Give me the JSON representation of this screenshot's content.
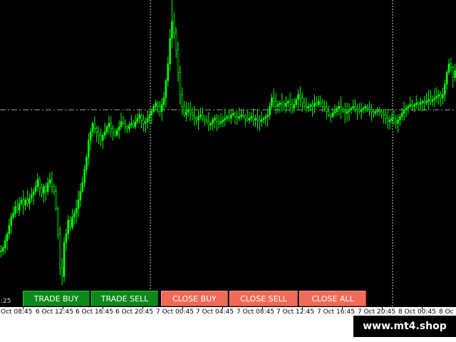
{
  "colors": {
    "background": "#000000",
    "candle": "#00ff00",
    "price_line": "#a0a0a0",
    "separator": "#c8c8c8",
    "button_green": "#0b8a1a",
    "button_red": "#f26a57"
  },
  "cursor_readout": ":25",
  "buttons": [
    {
      "id": "trade-buy",
      "label": "TRADE BUY",
      "color": "green"
    },
    {
      "id": "trade-sell",
      "label": "TRADE SELL",
      "color": "green"
    },
    {
      "id": "close-buy",
      "label": "CLOSE BUY",
      "color": "red"
    },
    {
      "id": "close-sell",
      "label": "CLOSE SELL",
      "color": "red"
    },
    {
      "id": "close-all",
      "label": "CLOSE ALL",
      "color": "red"
    }
  ],
  "time_axis": {
    "ticks": [
      "Oct 08:45",
      "6 Oct 12:45",
      "6 Oct 16:45",
      "6 Oct 20:45",
      "7 Oct 00:45",
      "7 Oct 04:45",
      "7 Oct 08:45",
      "7 Oct 12:45",
      "7 Oct 16:45",
      "7 Oct 20:45",
      "8 Oct 00:45",
      "8 Oc"
    ]
  },
  "watermark": "www.mt4.shop",
  "chart_data": {
    "type": "candlestick",
    "title": "",
    "grid": false,
    "price_line": {
      "style": "dash-dot"
    },
    "day_separators": [
      "7 Oct",
      "8 Oct"
    ],
    "closes": [
      0.2,
      0.22,
      0.26,
      0.3,
      0.35,
      0.4,
      0.42,
      0.46,
      0.44,
      0.48,
      0.5,
      0.47,
      0.5,
      0.48,
      0.51,
      0.53,
      0.55,
      0.58,
      0.62,
      0.57,
      0.54,
      0.58,
      0.55,
      0.6,
      0.62,
      0.58,
      0.55,
      0.45,
      0.3,
      0.1,
      0.05,
      0.25,
      0.3,
      0.38,
      0.34,
      0.4,
      0.42,
      0.45,
      0.5,
      0.55,
      0.6,
      0.68,
      0.75,
      0.85,
      0.9,
      0.95,
      0.92,
      0.9,
      0.88,
      0.85,
      0.88,
      0.9,
      0.93,
      0.95,
      0.92,
      0.9,
      0.88,
      0.91,
      0.93,
      0.96,
      0.95,
      0.93,
      0.92,
      0.94,
      0.95,
      0.93,
      0.96,
      0.98,
      1.0,
      0.97,
      0.95,
      0.96,
      0.98,
      1.0,
      1.02,
      1.05,
      1.07,
      1.05,
      1.02,
      1.06,
      1.1,
      1.2,
      1.3,
      1.45,
      1.55,
      1.48,
      1.38,
      1.25,
      1.12,
      1.05,
      1.0,
      1.02,
      1.03,
      1.01,
      1.0,
      0.98,
      0.97,
      0.99,
      1.0,
      0.98,
      0.97,
      0.96,
      0.94,
      0.95,
      0.97,
      0.98,
      0.96,
      0.95,
      0.96,
      0.97,
      0.98,
      0.99,
      0.98,
      1.0,
      1.01,
      0.99,
      0.98,
      0.99,
      1.0,
      0.99,
      0.98,
      0.97,
      0.98,
      0.99,
      0.97,
      0.98,
      0.97,
      0.96,
      0.97,
      0.98,
      0.99,
      1.0,
      1.05,
      1.1,
      1.08,
      1.05,
      1.06,
      1.07,
      1.06,
      1.05,
      1.07,
      1.08,
      1.06,
      1.04,
      1.06,
      1.09,
      1.12,
      1.1,
      1.07,
      1.05,
      1.04,
      1.05,
      1.06,
      1.05,
      1.07,
      1.06,
      1.08,
      1.07,
      1.05,
      1.04,
      1.02,
      1.0,
      0.99,
      1.01,
      1.02,
      1.04,
      1.05,
      1.03,
      1.02,
      1.01,
      1.02,
      1.03,
      1.04,
      1.05,
      1.04,
      1.03,
      1.02,
      1.03,
      1.04,
      1.05,
      1.04,
      1.03,
      1.02,
      1.01,
      1.02,
      1.03,
      1.02,
      1.01,
      1.0,
      0.98,
      0.96,
      0.97,
      0.98,
      0.96,
      0.95,
      0.97,
      0.99,
      1.01,
      1.03,
      1.04,
      1.05,
      1.06,
      1.05,
      1.06,
      1.07,
      1.06,
      1.07,
      1.08,
      1.07,
      1.08,
      1.09,
      1.08,
      1.09,
      1.1,
      1.11,
      1.12,
      1.1,
      1.12,
      1.18,
      1.25,
      1.3,
      1.28,
      1.22,
      1.26
    ],
    "value_range": [
      0,
      1.6
    ]
  }
}
